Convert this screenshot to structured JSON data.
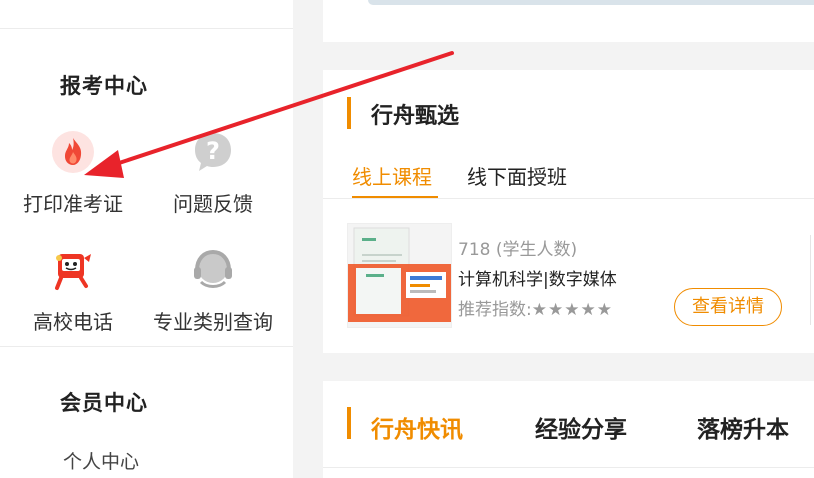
{
  "sidebar": {
    "exam_center_title": "报考中心",
    "items": [
      {
        "label": "打印准考证"
      },
      {
        "label": "问题反馈"
      },
      {
        "label": "高校电话"
      },
      {
        "label": "专业类别查询"
      }
    ],
    "member_center_title": "会员中心",
    "member_link": "个人中心"
  },
  "selection": {
    "title": "行舟甄选",
    "tabs": [
      "线上课程",
      "线下面授班"
    ],
    "active_tab": "线上课程",
    "course": {
      "students": "718 (学生人数)",
      "name": "计算机科学|数字媒体",
      "rating_label": "推荐指数:",
      "stars": "★★★★★",
      "rating": 5,
      "detail_button": "查看详情"
    }
  },
  "news": {
    "tabs": [
      "行舟快讯",
      "经验分享",
      "落榜升本"
    ],
    "active_tab": "行舟快讯"
  },
  "colors": {
    "accent": "#f08c00",
    "annotation_arrow": "#e8232b"
  },
  "icons": {
    "print_ticket": "flame-icon",
    "feedback": "question-bubble-icon",
    "university_phone": "mascot-phone-icon",
    "major_query": "headset-icon"
  }
}
